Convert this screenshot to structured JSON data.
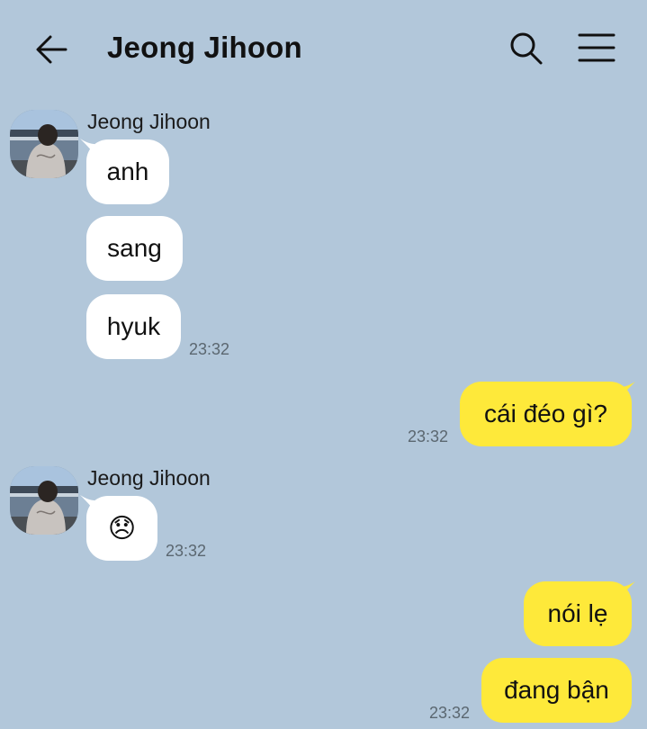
{
  "header": {
    "title": "Jeong Jihoon",
    "back_icon": "arrow-left-icon",
    "search_icon": "search-icon",
    "menu_icon": "menu-icon"
  },
  "colors": {
    "background": "#b2c7da",
    "incoming_bubble": "#ffffff",
    "outgoing_bubble": "#fee93a"
  },
  "messages": [
    {
      "sender": "Jeong Jihoon",
      "text": "anh",
      "time": ""
    },
    {
      "text": "sang",
      "time": ""
    },
    {
      "text": "hyuk",
      "time": "23:32"
    },
    {
      "text": "cái đéo gì?",
      "time": "23:32"
    },
    {
      "sender": "Jeong Jihoon",
      "text": "😞",
      "time": "23:32"
    },
    {
      "text": "nói lẹ",
      "time": ""
    },
    {
      "text": "đang bận",
      "time": "23:32"
    }
  ]
}
